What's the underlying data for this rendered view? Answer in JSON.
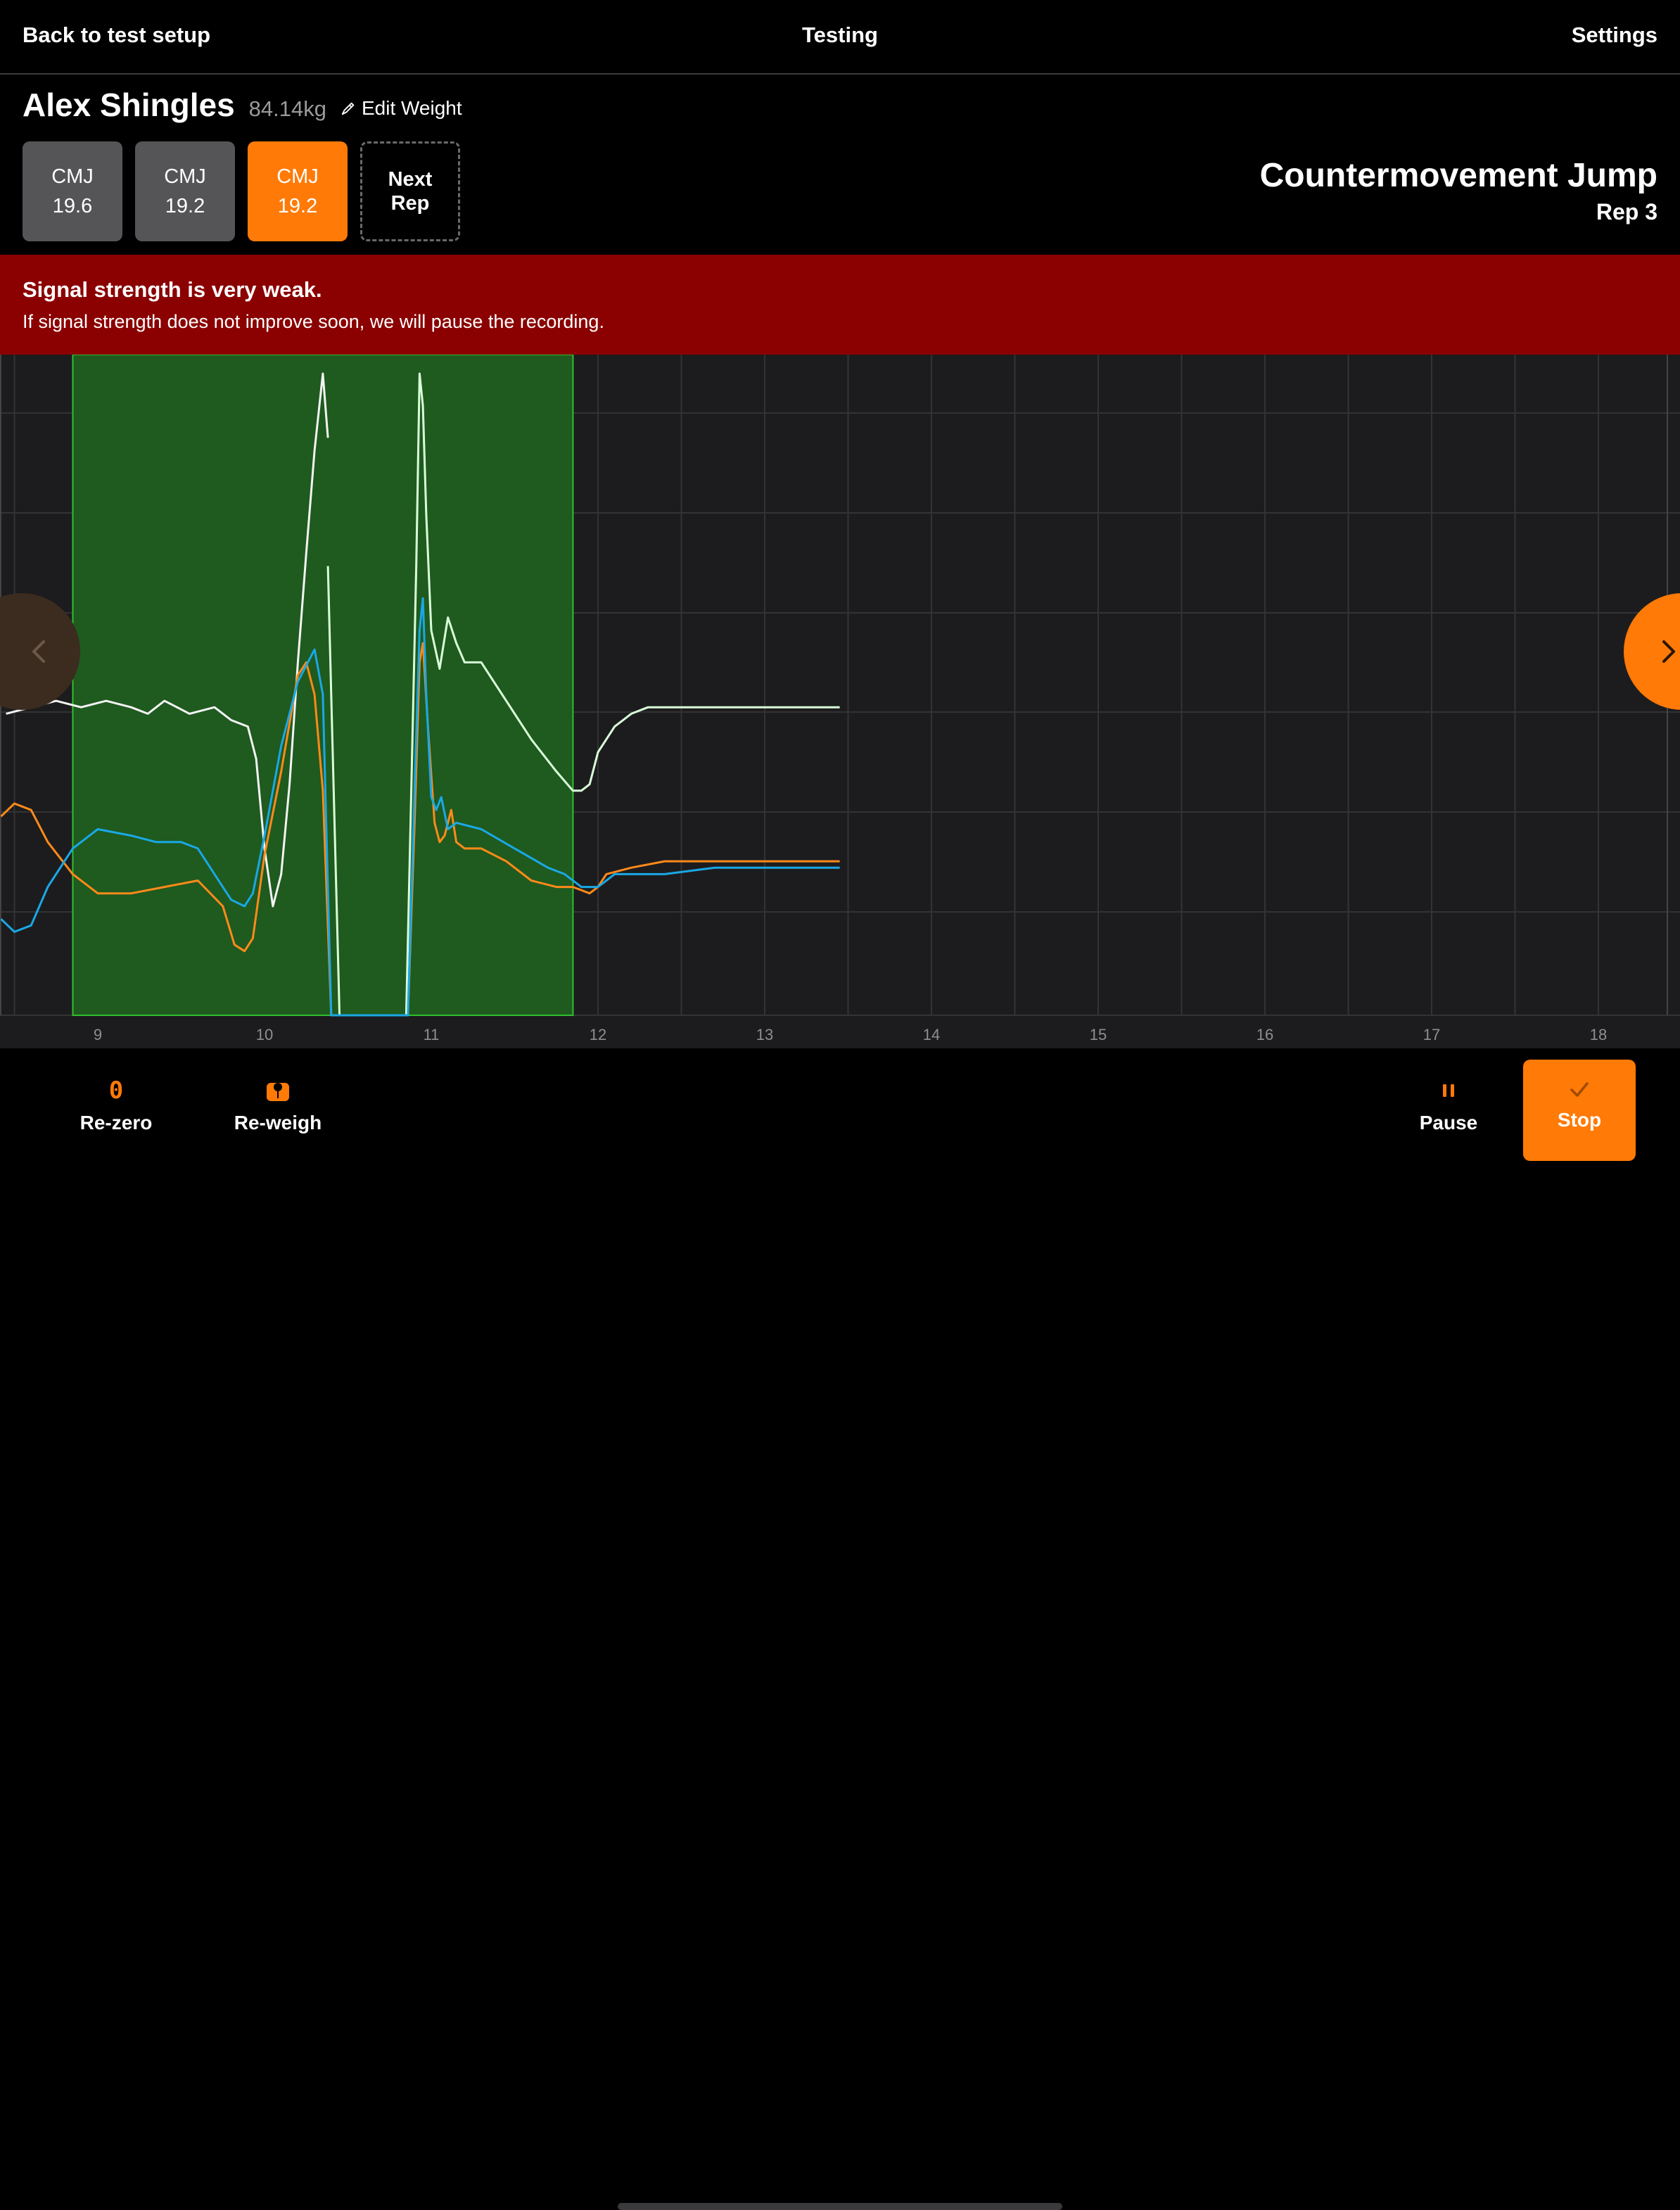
{
  "header": {
    "back_label": "Back to test setup",
    "title": "Testing",
    "settings_label": "Settings"
  },
  "athlete": {
    "name": "Alex Shingles",
    "weight": "84.14kg",
    "edit_label": "Edit Weight"
  },
  "reps": [
    {
      "label": "CMJ",
      "value": "19.6",
      "active": false
    },
    {
      "label": "CMJ",
      "value": "19.2",
      "active": false
    },
    {
      "label": "CMJ",
      "value": "19.2",
      "active": true
    }
  ],
  "next_rep": {
    "line1": "Next",
    "line2": "Rep"
  },
  "test": {
    "name": "Countermovement Jump",
    "rep": "Rep 3"
  },
  "alert": {
    "title": "Signal strength is very weak.",
    "body": "If signal strength does not improve soon, we will pause the recording."
  },
  "colors": {
    "accent": "#ff7a07",
    "alert_bg": "#8b0000",
    "highlight": "#1f5a1f",
    "white_trace": "#f4f4f4",
    "total_trace": "#d9ffd9",
    "orange_trace": "#ff8a1a",
    "blue_trace": "#1aa8e6"
  },
  "chart_data": {
    "type": "line",
    "x_ticks": [
      "9",
      "10",
      "11",
      "12",
      "13",
      "14",
      "15",
      "16",
      "17",
      "18"
    ],
    "xlim": [
      8.42,
      18.45
    ],
    "highlight_range": [
      8.85,
      11.85
    ],
    "series": [
      {
        "color": "#f4f4f4",
        "x": [
          8.45,
          8.6,
          8.75,
          8.9,
          9.05,
          9.2,
          9.3,
          9.4,
          9.55,
          9.7,
          9.8,
          9.9,
          9.95,
          10.0,
          10.05,
          10.1,
          10.15,
          10.2,
          10.25,
          10.3,
          10.35,
          10.38
        ],
        "y": [
          0.47,
          0.48,
          0.49,
          0.48,
          0.49,
          0.48,
          0.47,
          0.49,
          0.47,
          0.48,
          0.46,
          0.45,
          0.4,
          0.26,
          0.17,
          0.22,
          0.36,
          0.55,
          0.72,
          0.88,
          1.0,
          0.9
        ]
      },
      {
        "color": "#d9ffd9",
        "x": [
          10.38,
          10.42,
          10.45,
          10.5,
          10.6,
          10.7,
          10.8,
          10.85,
          10.88,
          10.91,
          10.93,
          10.95,
          10.97,
          11.0,
          11.05,
          11.1,
          11.15,
          11.2,
          11.3,
          11.45,
          11.6,
          11.75,
          11.85,
          11.9,
          11.95,
          12.0,
          12.1,
          12.2,
          12.3,
          12.5,
          12.7,
          12.9,
          13.1,
          13.3,
          13.45
        ],
        "y": [
          0.7,
          0.3,
          0.0,
          0.0,
          0.0,
          0.0,
          0.0,
          0.0,
          0.35,
          0.7,
          1.0,
          0.95,
          0.78,
          0.6,
          0.54,
          0.62,
          0.58,
          0.55,
          0.55,
          0.49,
          0.43,
          0.38,
          0.35,
          0.35,
          0.36,
          0.41,
          0.45,
          0.47,
          0.48,
          0.48,
          0.48,
          0.48,
          0.48,
          0.48,
          0.48
        ]
      },
      {
        "color": "#ff8a1a",
        "x": [
          8.42,
          8.5,
          8.6,
          8.7,
          8.85,
          9.0,
          9.2,
          9.4,
          9.6,
          9.75,
          9.82,
          9.88,
          9.93,
          10.0,
          10.1,
          10.2,
          10.25,
          10.3,
          10.35,
          10.4,
          10.45,
          10.5,
          10.6,
          10.7,
          10.8,
          10.86,
          10.9,
          10.93,
          10.95,
          10.98,
          11.02,
          11.05,
          11.08,
          11.12,
          11.15,
          11.2,
          11.3,
          11.45,
          11.6,
          11.75,
          11.85,
          11.95,
          12.0,
          12.05,
          12.2,
          12.4,
          12.6,
          12.8,
          13.0,
          13.2,
          13.45
        ],
        "y": [
          0.31,
          0.33,
          0.32,
          0.27,
          0.22,
          0.19,
          0.19,
          0.2,
          0.21,
          0.17,
          0.11,
          0.1,
          0.12,
          0.25,
          0.38,
          0.53,
          0.55,
          0.5,
          0.35,
          0.0,
          0.0,
          0.0,
          0.0,
          0.0,
          0.0,
          0.0,
          0.3,
          0.55,
          0.58,
          0.45,
          0.3,
          0.27,
          0.28,
          0.32,
          0.27,
          0.26,
          0.26,
          0.24,
          0.21,
          0.2,
          0.2,
          0.19,
          0.2,
          0.22,
          0.23,
          0.24,
          0.24,
          0.24,
          0.24,
          0.24,
          0.24
        ]
      },
      {
        "color": "#1aa8e6",
        "x": [
          8.42,
          8.5,
          8.6,
          8.7,
          8.85,
          9.0,
          9.2,
          9.35,
          9.5,
          9.6,
          9.7,
          9.8,
          9.88,
          9.93,
          10.0,
          10.1,
          10.2,
          10.3,
          10.35,
          10.4,
          10.45,
          10.5,
          10.6,
          10.7,
          10.8,
          10.86,
          10.9,
          10.93,
          10.95,
          10.97,
          11.0,
          11.03,
          11.06,
          11.1,
          11.15,
          11.3,
          11.5,
          11.7,
          11.8,
          11.9,
          12.0,
          12.05,
          12.1,
          12.2,
          12.4,
          12.7,
          13.0,
          13.3,
          13.45
        ],
        "y": [
          0.15,
          0.13,
          0.14,
          0.2,
          0.26,
          0.29,
          0.28,
          0.27,
          0.27,
          0.26,
          0.22,
          0.18,
          0.17,
          0.19,
          0.28,
          0.42,
          0.52,
          0.57,
          0.5,
          0.0,
          0.0,
          0.0,
          0.0,
          0.0,
          0.0,
          0.0,
          0.35,
          0.6,
          0.65,
          0.5,
          0.34,
          0.32,
          0.34,
          0.29,
          0.3,
          0.29,
          0.26,
          0.23,
          0.22,
          0.2,
          0.2,
          0.21,
          0.22,
          0.22,
          0.22,
          0.23,
          0.23,
          0.23,
          0.23
        ]
      }
    ]
  },
  "toolbar": {
    "rezero": {
      "icon": "zero-glyph",
      "glyph": "0",
      "label": "Re-zero"
    },
    "reweigh": {
      "icon": "weight-icon",
      "label": "Re-weigh"
    },
    "pause": {
      "icon": "pause-icon",
      "label": "Pause"
    },
    "stop": {
      "icon": "check-icon",
      "label": "Stop"
    }
  }
}
